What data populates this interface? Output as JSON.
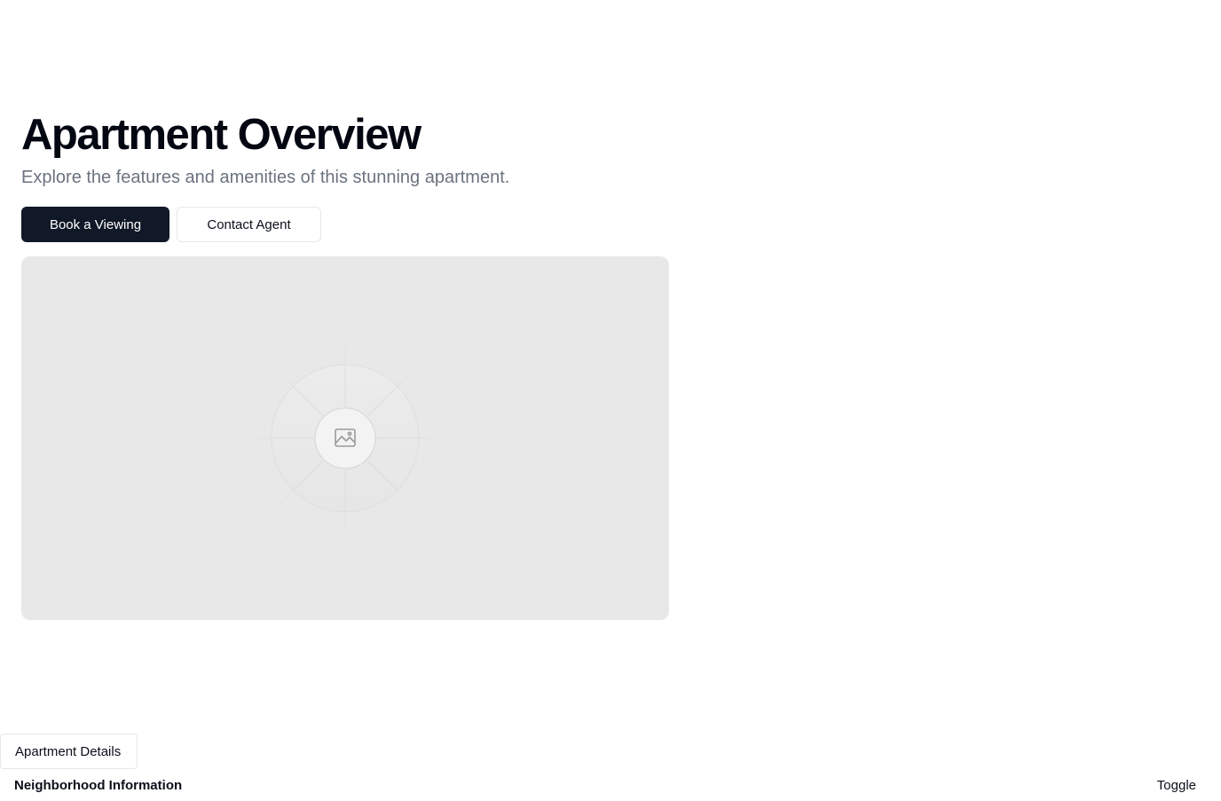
{
  "hero": {
    "title": "Apartment Overview",
    "subtitle": "Explore the features and amenities of this stunning apartment.",
    "primary_button": "Book a Viewing",
    "secondary_button": "Contact Agent"
  },
  "media": {
    "icon": "image-placeholder-icon",
    "background_color": "#e8e8e8"
  },
  "sections": {
    "details_tab": "Apartment Details",
    "neighborhood_label": "Neighborhood Information",
    "toggle_label": "Toggle"
  },
  "colors": {
    "primary": "#111827",
    "muted_text": "#6b7280",
    "border": "#e5e7eb"
  }
}
